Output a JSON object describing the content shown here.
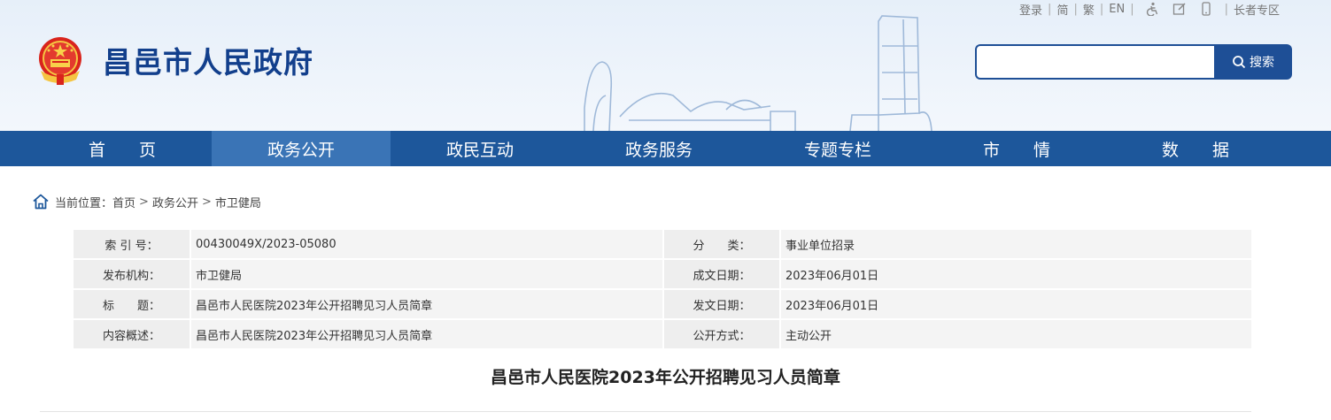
{
  "header": {
    "site_title": "昌邑市人民政府",
    "toplinks": {
      "login": "登录",
      "simplified": "简",
      "traditional": "繁",
      "english": "EN",
      "elder": "长者专区"
    },
    "search": {
      "placeholder": "",
      "button_label": "搜索"
    }
  },
  "nav": {
    "items": [
      {
        "label": "首　　页",
        "active": false
      },
      {
        "label": "政务公开",
        "active": true
      },
      {
        "label": "政民互动",
        "active": false
      },
      {
        "label": "政务服务",
        "active": false
      },
      {
        "label": "专题专栏",
        "active": false
      },
      {
        "label": "市　　情",
        "active": false
      },
      {
        "label": "数　　据",
        "active": false
      }
    ]
  },
  "breadcrumb": {
    "prefix": "当前位置：",
    "items": [
      "首页",
      "政务公开",
      "市卫健局"
    ],
    "sep": ">"
  },
  "info": {
    "rows": [
      {
        "label": "索 引 号：",
        "value": "00430049X/2023-05080",
        "label2": "分　　类：",
        "value2": "事业单位招录"
      },
      {
        "label": "发布机构：",
        "value": "市卫健局",
        "label2": "成文日期：",
        "value2": "2023年06月01日"
      },
      {
        "label": "标　　题：",
        "value": "昌邑市人民医院2023年公开招聘见习人员简章",
        "label2": "发文日期：",
        "value2": "2023年06月01日"
      },
      {
        "label": "内容概述：",
        "value": "昌邑市人民医院2023年公开招聘见习人员简章",
        "label2": "公开方式：",
        "value2": "主动公开"
      }
    ]
  },
  "article": {
    "title": "昌邑市人民医院2023年公开招聘见习人员简章"
  },
  "colors": {
    "primary": "#1d579b",
    "nav_active": "#3a74b6",
    "title": "#123f8c"
  }
}
